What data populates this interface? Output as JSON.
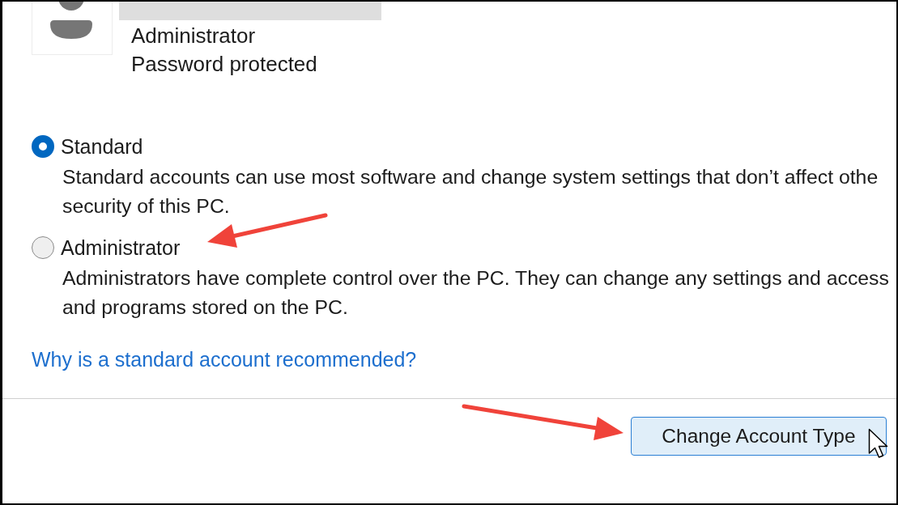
{
  "account": {
    "role": "Administrator",
    "status": "Password protected"
  },
  "account_types": [
    {
      "label": "Standard",
      "selected": true,
      "marked_by_arrow": false,
      "description": [
        "Standard accounts can use most software and change system settings that don’t affect othe",
        "security of this PC."
      ]
    },
    {
      "label": "Administrator",
      "selected": false,
      "marked_by_arrow": true,
      "description": [
        "Administrators have complete control over the PC. They can change any settings and access",
        "and programs stored on the PC."
      ]
    }
  ],
  "help_link": "Why is a standard account recommended?",
  "button": {
    "label": "Change Account Type",
    "hovered": true,
    "marked_by_arrow": true
  }
}
